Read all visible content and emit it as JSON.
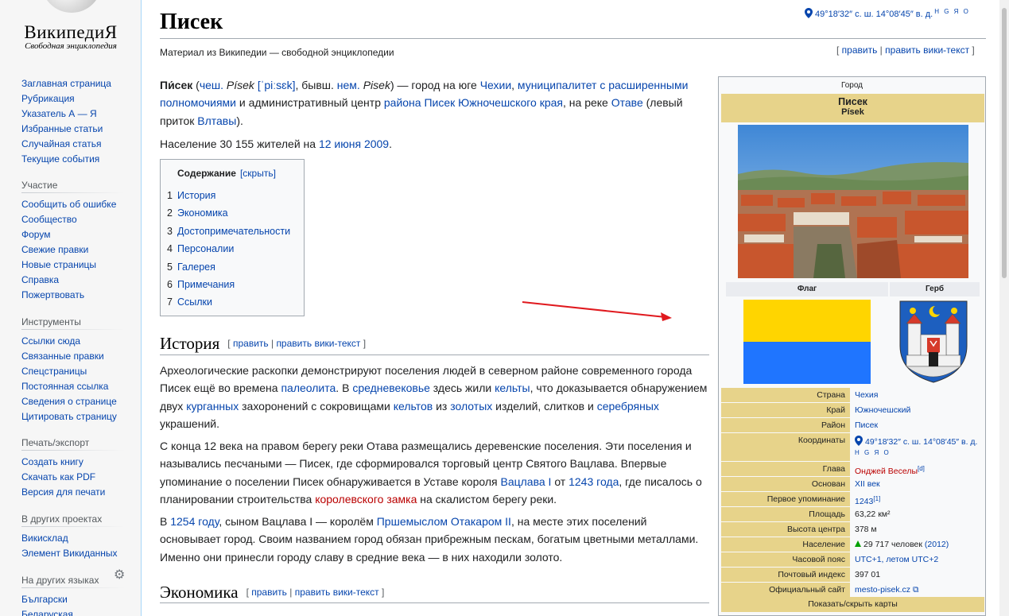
{
  "sidebar": {
    "wordmark": "ВикипедиЯ",
    "tagline": "Свободная энциклопедия",
    "nav": [
      "Заглавная страница",
      "Рубрикация",
      "Указатель А — Я",
      "Избранные статьи",
      "Случайная статья",
      "Текущие события"
    ],
    "participation": {
      "title": "Участие",
      "items": [
        "Сообщить об ошибке",
        "Сообщество",
        "Форум",
        "Свежие правки",
        "Новые страницы",
        "Справка",
        "Пожертвовать"
      ]
    },
    "tools": {
      "title": "Инструменты",
      "items": [
        "Ссылки сюда",
        "Связанные правки",
        "Спецстраницы",
        "Постоянная ссылка",
        "Сведения о странице",
        "Цитировать страницу"
      ]
    },
    "print": {
      "title": "Печать/экспорт",
      "items": [
        "Создать книгу",
        "Скачать как PDF",
        "Версия для печати"
      ]
    },
    "projects": {
      "title": "В других проектах",
      "items": [
        "Викисклад",
        "Элемент Викиданных"
      ]
    },
    "languages": {
      "title": "На других языках",
      "items": [
        "Български",
        "Беларуская"
      ]
    }
  },
  "header": {
    "coords": "49°18′32″ с. ш. 14°08′45″ в. д.",
    "coords_links": "H G Я O",
    "title": "Писек",
    "subtitle": "Материал из Википедии — свободной энциклопедии",
    "edit": "править",
    "edit_source": "править вики-текст"
  },
  "intro": {
    "p1": [
      {
        "t": "Пи́сек",
        "s": "b"
      },
      {
        "t": " ("
      },
      {
        "t": "чеш.",
        "s": "a"
      },
      {
        "t": " "
      },
      {
        "t": "Písek",
        "s": "i"
      },
      {
        "t": " "
      },
      {
        "t": "[ˈpiːsɛk]",
        "s": "a"
      },
      {
        "t": ", бывш. "
      },
      {
        "t": "нем.",
        "s": "a"
      },
      {
        "t": " "
      },
      {
        "t": "Pisek",
        "s": "i"
      },
      {
        "t": ") — город на юге "
      },
      {
        "t": "Чехии",
        "s": "a"
      },
      {
        "t": ", "
      },
      {
        "t": "муниципалитет с расширенными полномочиями",
        "s": "a"
      },
      {
        "t": " и административный центр "
      },
      {
        "t": "района Писек",
        "s": "a"
      },
      {
        "t": " "
      },
      {
        "t": "Южночешского края",
        "s": "a"
      },
      {
        "t": ", на реке "
      },
      {
        "t": "Отаве",
        "s": "a"
      },
      {
        "t": " (левый приток "
      },
      {
        "t": "Влтавы",
        "s": "a"
      },
      {
        "t": ")."
      }
    ],
    "p2": [
      {
        "t": "Население 30 155 жителей на "
      },
      {
        "t": "12 июня 2009",
        "s": "a"
      },
      {
        "t": "."
      }
    ]
  },
  "toc": {
    "title": "Содержание",
    "toggle": "[скрыть]",
    "items": [
      {
        "n": "1",
        "label": "История"
      },
      {
        "n": "2",
        "label": "Экономика"
      },
      {
        "n": "3",
        "label": "Достопримечательности"
      },
      {
        "n": "4",
        "label": "Персоналии"
      },
      {
        "n": "5",
        "label": "Галерея"
      },
      {
        "n": "6",
        "label": "Примечания"
      },
      {
        "n": "7",
        "label": "Ссылки"
      }
    ]
  },
  "history": {
    "heading": "История",
    "p1": [
      {
        "t": "Археологические раскопки демонстрируют поселения людей в северном районе современного города Писек ещё во времена "
      },
      {
        "t": "палеолита",
        "s": "a"
      },
      {
        "t": ". В "
      },
      {
        "t": "средневековье",
        "s": "a"
      },
      {
        "t": " здесь жили "
      },
      {
        "t": "кельты",
        "s": "a"
      },
      {
        "t": ", что доказывается обнаружением двух "
      },
      {
        "t": "курганных",
        "s": "a"
      },
      {
        "t": " захоронений с сокровищами "
      },
      {
        "t": "кельтов",
        "s": "a"
      },
      {
        "t": " из "
      },
      {
        "t": "золотых",
        "s": "a"
      },
      {
        "t": " изделий, слитков и "
      },
      {
        "t": "серебряных",
        "s": "a"
      },
      {
        "t": " украшений."
      }
    ],
    "p2": [
      {
        "t": "С конца 12 века на правом берегу реки Отава размещались деревенские поселения. Эти поселения и назывались песчаными — Писек, где сформировался торговый центр Святого Вацлава. Впервые упоминание о поселении Писек обнаруживается в Уставе короля "
      },
      {
        "t": "Вацлава I",
        "s": "a"
      },
      {
        "t": " от "
      },
      {
        "t": "1243 года",
        "s": "a"
      },
      {
        "t": ", где писалось о планировании строительства "
      },
      {
        "t": "королевского замка",
        "s": "r"
      },
      {
        "t": " на скалистом берегу реки."
      }
    ],
    "p3": [
      {
        "t": "В "
      },
      {
        "t": "1254 году",
        "s": "a"
      },
      {
        "t": ", сыном Вацлава I — королём "
      },
      {
        "t": "Пршемыслом Отакаром II",
        "s": "a"
      },
      {
        "t": ", на месте этих поселений основывает город. Своим названием город обязан прибрежным пескам, богатым цветными металлами. Именно они принесли городу славу в средние века — в них находили золото."
      }
    ]
  },
  "economy": {
    "heading": "Экономика"
  },
  "infobox": {
    "kind": "Город",
    "name": "Писек",
    "local_name": "Písek",
    "flag_label": "Флаг",
    "coat_label": "Герб",
    "rows": [
      {
        "k": "Страна",
        "v": "Чехия",
        "link": true
      },
      {
        "k": "Край",
        "v": "Южночешский",
        "link": true
      },
      {
        "k": "Район",
        "v": "Писек",
        "link": true
      },
      {
        "k": "Координаты",
        "v": "49°18′32″ с. ш. 14°08′45″ в. д.",
        "extra": "H G Я O",
        "link": true,
        "tall": true,
        "pin": true
      },
      {
        "k": "Глава",
        "v": "Онджей Веселы",
        "sup": "[d]",
        "red": true
      },
      {
        "k": "Основан",
        "v": "XII век",
        "link": true
      },
      {
        "k": "Первое упоминание",
        "v": "1243",
        "sup": "[1]",
        "link": true
      },
      {
        "k": "Площадь",
        "v": "63,22 км²"
      },
      {
        "k": "Высота центра",
        "v": "378 м"
      },
      {
        "k": "Население",
        "v": "29 717 человек",
        "extra": "(2012)",
        "tri": true
      },
      {
        "k": "Часовой пояс",
        "v": "UTC+1, летом UTC+2",
        "link": true
      },
      {
        "k": "Почтовый индекс",
        "v": "397 01"
      },
      {
        "k": "Официальный сайт",
        "v": "mesto-pisek.cz",
        "link": true
      }
    ],
    "map_toggle": "Показать/скрыть карты"
  },
  "colors": {
    "link": "#0645ad",
    "redlink": "#ba0000",
    "infobox_header": "#e7d38a",
    "flag_yellow": "#ffd500",
    "flag_blue": "#1f75ff"
  }
}
